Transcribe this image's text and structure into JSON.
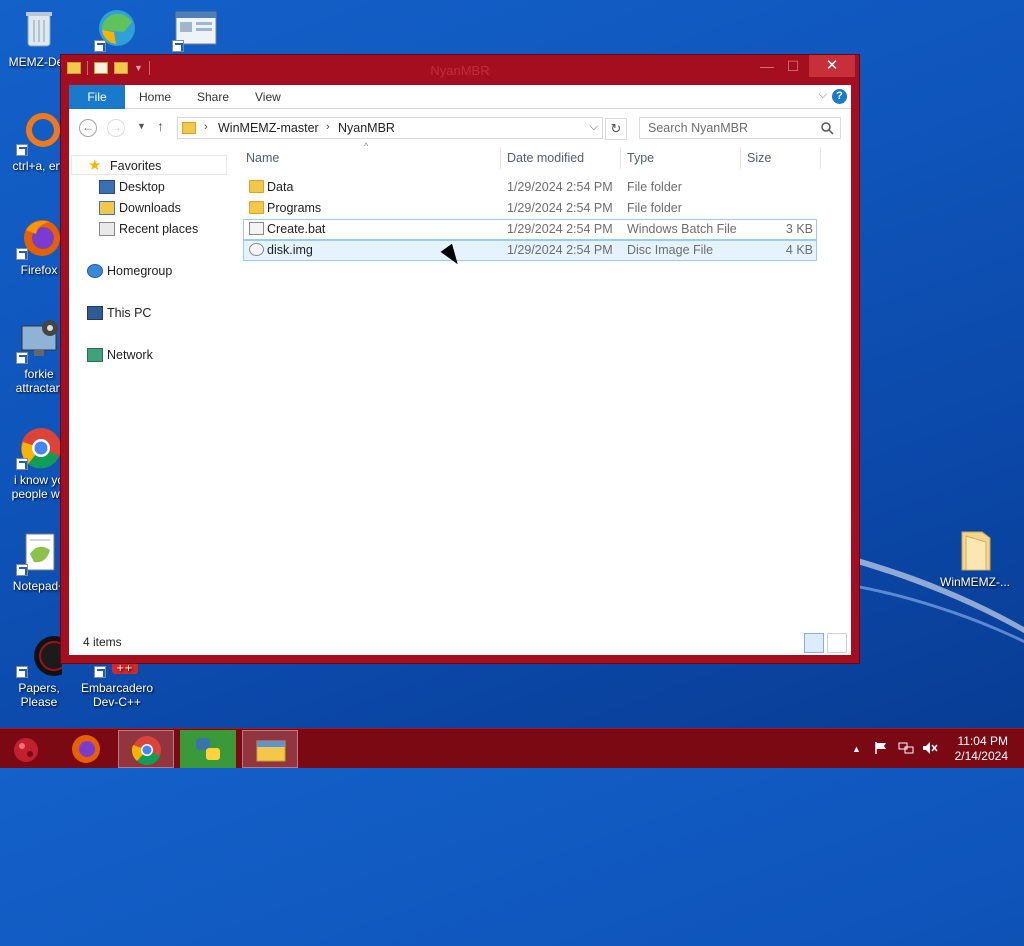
{
  "desktop": {
    "icons": [
      {
        "label": "MEMZ-Des",
        "icon": "recycle-bin-icon"
      },
      {
        "label": "",
        "icon": "edge-icon"
      },
      {
        "label": "",
        "icon": "app-window-icon"
      },
      {
        "label": "ctrl+a, ent",
        "icon": "orange-ring-icon"
      },
      {
        "label": "Firefox",
        "icon": "firefox-icon"
      },
      {
        "label": "forkie attractan",
        "icon": "gear-computer-icon"
      },
      {
        "label": "i know yo people we",
        "icon": "chrome-icon"
      },
      {
        "label": "Notepad+",
        "icon": "notepad-plus-icon"
      },
      {
        "label": "Papers, Please",
        "icon": "papers-please-icon"
      },
      {
        "label": "Embarcadero Dev-C++",
        "icon": "devcpp-icon"
      },
      {
        "label": "WinMEMZ-...",
        "icon": "folder-icon"
      }
    ]
  },
  "window": {
    "title": "NyanMBR",
    "close_glyph": "✕",
    "minimize_glyph": "—",
    "maximize_glyph": "☐",
    "ribbon_tabs": {
      "file": "File",
      "home": "Home",
      "share": "Share",
      "view": "View"
    },
    "address": {
      "part1": "WinMEMZ-master",
      "part2": "NyanMBR"
    },
    "search_placeholder": "Search NyanMBR",
    "nav": {
      "favorites": "Favorites",
      "desktop": "Desktop",
      "downloads": "Downloads",
      "recent": "Recent places",
      "homegroup": "Homegroup",
      "thispc": "This PC",
      "network": "Network"
    },
    "columns": {
      "name": "Name",
      "date": "Date modified",
      "type": "Type",
      "size": "Size"
    },
    "files": [
      {
        "name": "Data",
        "date": "1/29/2024 2:54 PM",
        "type": "File folder",
        "size": "",
        "kind": "folder"
      },
      {
        "name": "Programs",
        "date": "1/29/2024 2:54 PM",
        "type": "File folder",
        "size": "",
        "kind": "folder"
      },
      {
        "name": "Create.bat",
        "date": "1/29/2024 2:54 PM",
        "type": "Windows Batch File",
        "size": "3 KB",
        "kind": "bat"
      },
      {
        "name": "disk.img",
        "date": "1/29/2024 2:54 PM",
        "type": "Disc Image File",
        "size": "4 KB",
        "kind": "img"
      }
    ],
    "status": "4 items"
  },
  "taskbar": {
    "time": "11:04 PM",
    "date": "2/14/2024",
    "tray_up": "▲"
  },
  "colors": {
    "window_frame": "#a40e1e",
    "taskbar": "#7a0914",
    "file_tab": "#1979ca"
  }
}
